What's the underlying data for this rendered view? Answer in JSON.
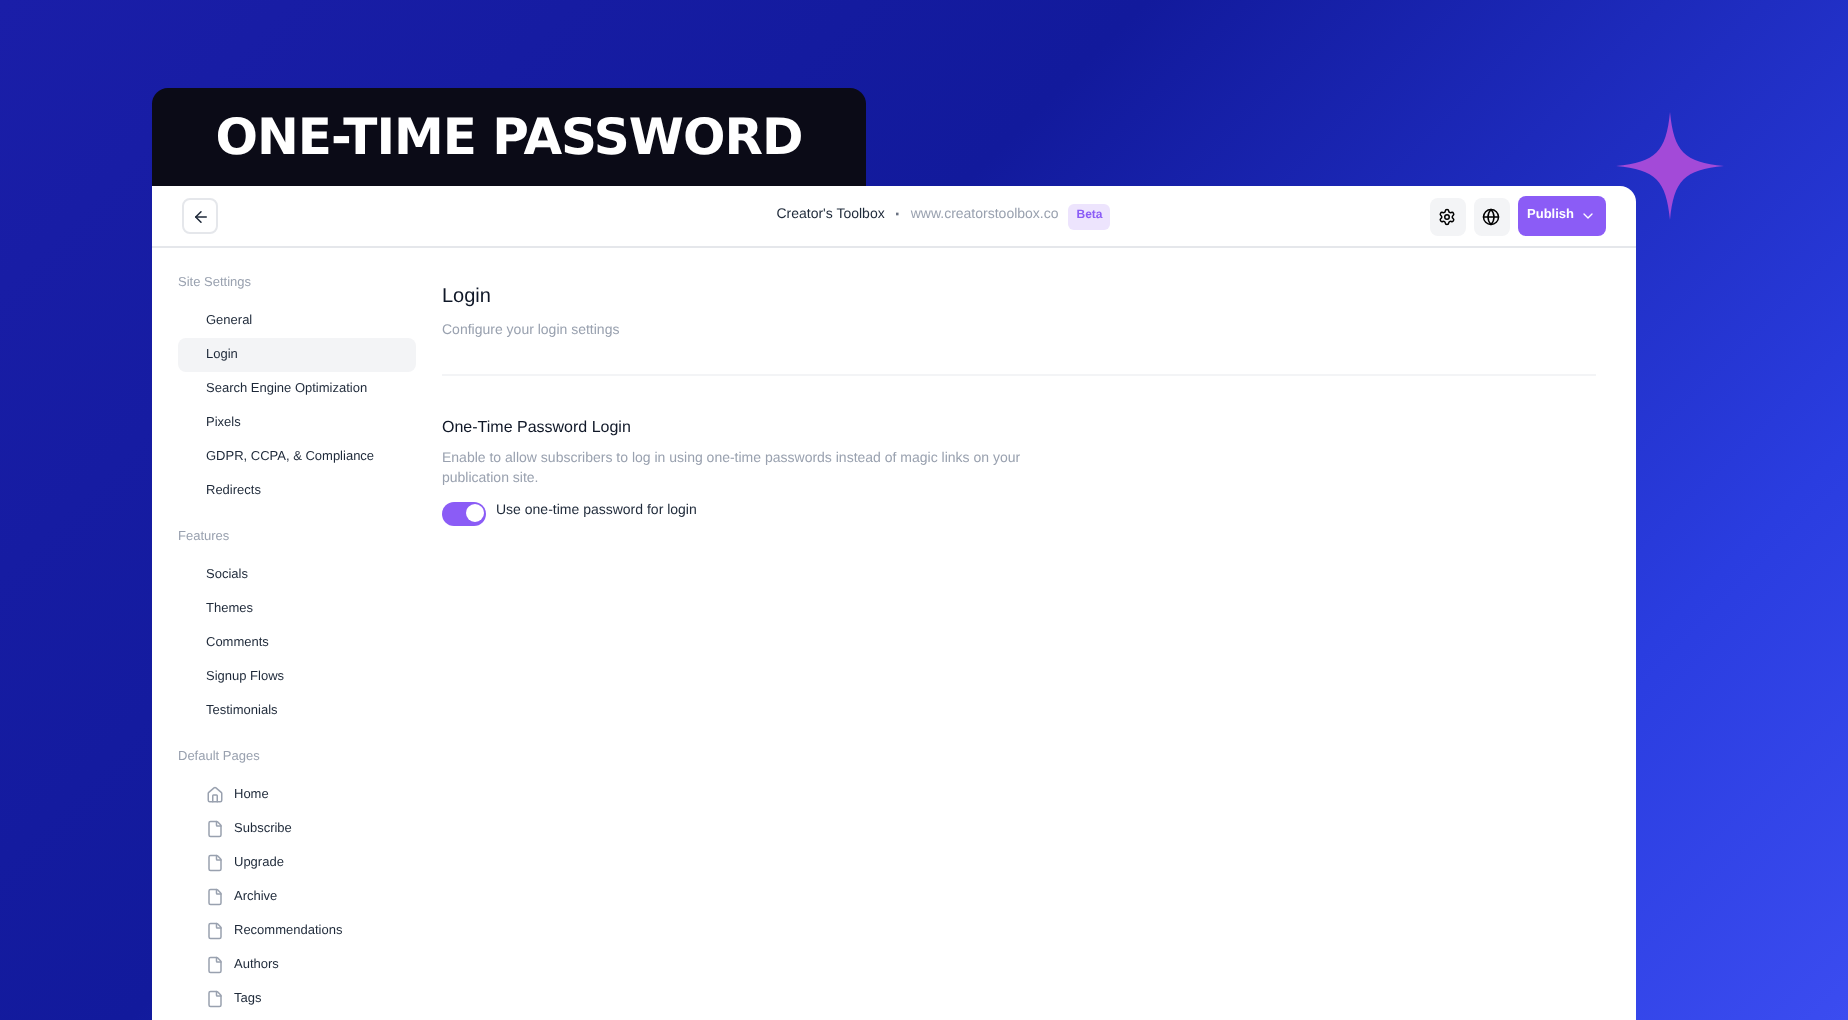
{
  "banner": {
    "title": "ONE-TIME PASSWORD"
  },
  "header": {
    "site_name": "Creator's Toolbox",
    "separator": "·",
    "site_url": "www.creatorstoolbox.co",
    "badge": "Beta",
    "publish_button": "Publish"
  },
  "sidebar": {
    "groups": [
      {
        "heading": "Site Settings",
        "items": [
          {
            "label": "General",
            "selected": false,
            "kind": "plain"
          },
          {
            "label": "Login",
            "selected": true,
            "kind": "plain"
          },
          {
            "label": "Search Engine Optimization",
            "selected": false,
            "kind": "plain"
          },
          {
            "label": "Pixels",
            "selected": false,
            "kind": "plain"
          },
          {
            "label": "GDPR, CCPA, & Compliance",
            "selected": false,
            "kind": "plain"
          },
          {
            "label": "Redirects",
            "selected": false,
            "kind": "plain"
          }
        ]
      },
      {
        "heading": "Features",
        "items": [
          {
            "label": "Socials",
            "selected": false,
            "kind": "plain"
          },
          {
            "label": "Themes",
            "selected": false,
            "kind": "plain"
          },
          {
            "label": "Comments",
            "selected": false,
            "kind": "plain"
          },
          {
            "label": "Signup Flows",
            "selected": false,
            "kind": "plain"
          },
          {
            "label": "Testimonials",
            "selected": false,
            "kind": "plain"
          }
        ]
      },
      {
        "heading": "Default Pages",
        "items": [
          {
            "label": "Home",
            "selected": false,
            "kind": "home"
          },
          {
            "label": "Subscribe",
            "selected": false,
            "kind": "page"
          },
          {
            "label": "Upgrade",
            "selected": false,
            "kind": "page"
          },
          {
            "label": "Archive",
            "selected": false,
            "kind": "page"
          },
          {
            "label": "Recommendations",
            "selected": false,
            "kind": "page"
          },
          {
            "label": "Authors",
            "selected": false,
            "kind": "page"
          },
          {
            "label": "Tags",
            "selected": false,
            "kind": "page"
          }
        ]
      }
    ]
  },
  "content": {
    "title": "Login",
    "subtitle": "Configure your login settings",
    "section": {
      "title": "One-Time Password Login",
      "description": "Enable to allow subscribers to log in using one-time passwords instead of magic links on your publication site.",
      "toggle": {
        "label": "Use one-time password for login",
        "on": true
      }
    }
  }
}
